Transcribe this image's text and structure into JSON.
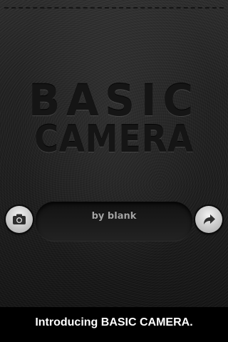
{
  "app": {
    "title_line1": "BASIC",
    "title_line2": "CAMERA",
    "brand": "by blank"
  },
  "buttons": {
    "left_icon": "camera-icon",
    "right_icon": "share-arrow-icon"
  },
  "caption": {
    "text": "Introducing BASIC CAMERA."
  },
  "colors": {
    "leather_dark": "#1a1a1a",
    "title_emboss": "#151515",
    "brand_text": "#a4a4a4",
    "button_light": "#d0d0d0",
    "caption_text": "#ffffff",
    "caption_bg": "#000000"
  }
}
